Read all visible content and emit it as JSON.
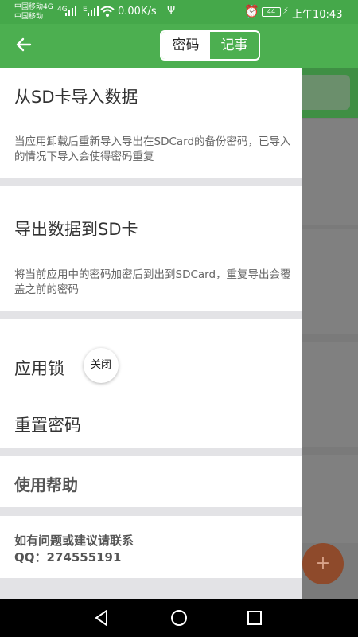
{
  "status_bar": {
    "carrier_1": "中国移动4G",
    "carrier_2": "中国移动",
    "sig_1": "4G",
    "sig_2": "E",
    "net_speed": "0.00K/s",
    "battery": "44",
    "time": "上午10:43"
  },
  "header": {
    "tabs": [
      {
        "label": "密码",
        "selected": true
      },
      {
        "label": "记事",
        "selected": false
      }
    ]
  },
  "drawer": {
    "import": {
      "title": "从SD卡导入数据",
      "desc": "当应用卸载后重新导入导出在SDCard的备份密码，已导入的情况下导入会使得密码重复"
    },
    "export": {
      "title": "导出数据到SD卡",
      "desc": "将当前应用中的密码加密后到出到SDCard，重复导出会覆盖之前的密码"
    },
    "app_lock": {
      "label": "应用锁",
      "toggle": "关闭"
    },
    "reset_password": {
      "label": "重置密码"
    },
    "help": {
      "label": "使用帮助"
    },
    "contact": {
      "line1": "如有问题或建议请联系",
      "line2": "QQ：274555191"
    }
  },
  "fab": {
    "icon": "plus-icon",
    "label": "+"
  },
  "colors": {
    "primary": "#4caf50",
    "status": "#45a84a",
    "fab": "#8e4a2b"
  }
}
